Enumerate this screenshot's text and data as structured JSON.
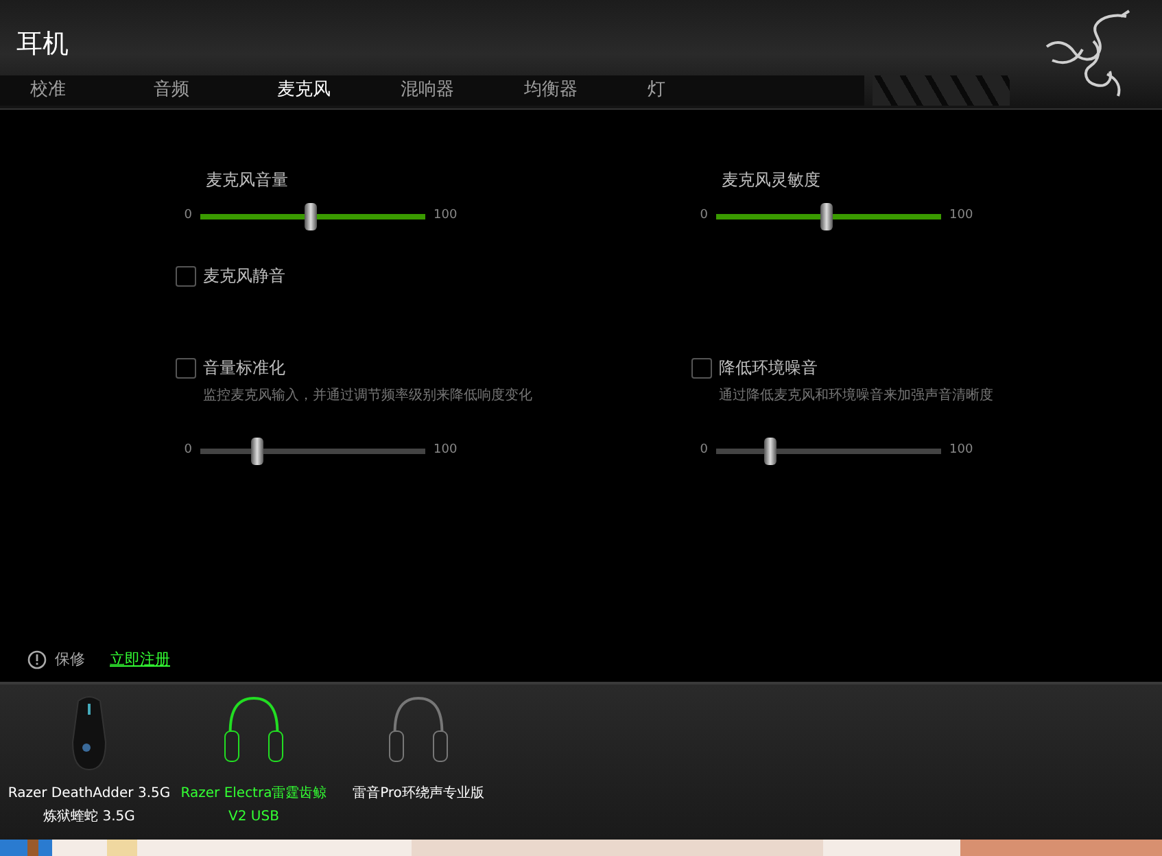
{
  "window": {
    "title": "耳机"
  },
  "tabs": [
    {
      "label": "校准",
      "selected": false
    },
    {
      "label": "音频",
      "selected": false
    },
    {
      "label": "麦克风",
      "selected": true
    },
    {
      "label": "混响器",
      "selected": false
    },
    {
      "label": "均衡器",
      "selected": false
    },
    {
      "label": "灯",
      "selected": false
    }
  ],
  "columns": [
    {
      "items": [
        {
          "kind": "slider",
          "label": "麦克风音量",
          "min": "0",
          "max": "100",
          "level": 0.49,
          "active": true
        },
        {
          "kind": "checkbox",
          "label": "麦克风静音",
          "checked": false
        },
        {
          "kind": "checkbox",
          "label": "音量标准化",
          "checked": false,
          "description": "监控麦克风输入，并通过调节频率级别来降低响度变化"
        },
        {
          "kind": "slider",
          "min": "0",
          "max": "100",
          "level": 0.25,
          "active": false
        }
      ]
    },
    {
      "items": [
        {
          "kind": "slider",
          "label": "麦克风灵敏度",
          "min": "0",
          "max": "100",
          "level": 0.49,
          "active": true
        },
        {
          "kind": "gap"
        },
        {
          "kind": "checkbox",
          "label": "降低环境噪音",
          "checked": false,
          "description": "通过降低麦克风和环境噪音来加强声音清晰度"
        },
        {
          "kind": "slider",
          "min": "0",
          "max": "100",
          "level": 0.24,
          "active": false
        }
      ]
    }
  ],
  "warranty": {
    "label": "保修",
    "link": "立即注册"
  },
  "devices": [
    {
      "kind": "mouse",
      "name": "Razer DeathAdder 3.5G",
      "subtitle": "炼狱蝰蛇 3.5G",
      "selected": false
    },
    {
      "kind": "headset",
      "name": "Razer Electra雷霆齿鲸",
      "subtitle": "V2 USB",
      "selected": true
    },
    {
      "kind": "headset",
      "name": "雷音Pro环绕声专业版",
      "selected": false
    }
  ]
}
